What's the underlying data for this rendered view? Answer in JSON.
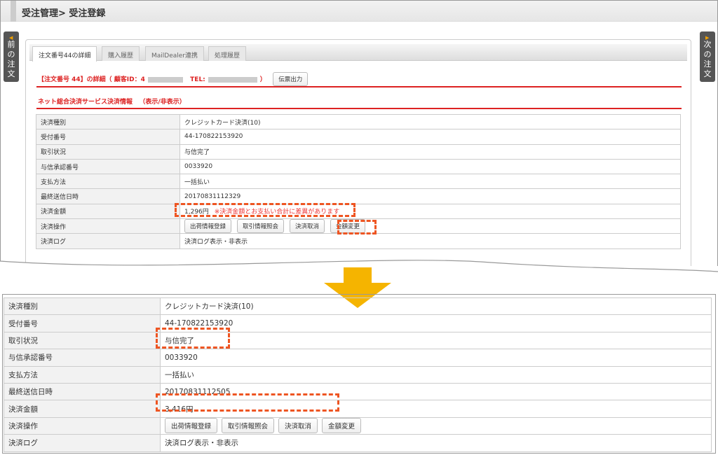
{
  "header": {
    "breadcrumb": "受注管理> 受注登録"
  },
  "side": {
    "prev": [
      "前",
      "の",
      "注",
      "文"
    ],
    "next": [
      "次",
      "の",
      "注",
      "文"
    ]
  },
  "tabs": [
    "注文番号44の詳細",
    "購入履歴",
    "MailDealer連携",
    "処理履歴"
  ],
  "order": {
    "title": "【注文番号 44】の詳細（ 顧客ID：4",
    "tel": "TEL:",
    "close": "）",
    "slip_button": "伝票出力"
  },
  "section": {
    "title": "ネット総合決済サービス決済情報",
    "toggle": "（表示/非表示）"
  },
  "before": {
    "rows": [
      {
        "label": "決済種別",
        "value": "クレジットカード決済(10)"
      },
      {
        "label": "受付番号",
        "value": "44-170822153920"
      },
      {
        "label": "取引状況",
        "value": "与信完了"
      },
      {
        "label": "与信承認番号",
        "value": "0033920"
      },
      {
        "label": "支払方法",
        "value": "一括払い"
      },
      {
        "label": "最終送信日時",
        "value": "20170831112329"
      },
      {
        "label": "決済金額",
        "value": "1,296円",
        "warning": "※決済金額とお支払い合計に差異があります"
      },
      {
        "label": "決済操作"
      },
      {
        "label": "決済ログ",
        "value": "決済ログ表示・非表示"
      }
    ]
  },
  "after": {
    "rows": [
      {
        "label": "決済種別",
        "value": "クレジットカード決済(10)"
      },
      {
        "label": "受付番号",
        "value": "44-170822153920"
      },
      {
        "label": "取引状況",
        "value": "与信完了"
      },
      {
        "label": "与信承認番号",
        "value": "0033920"
      },
      {
        "label": "支払方法",
        "value": "一括払い"
      },
      {
        "label": "最終送信日時",
        "value": "20170831112505"
      },
      {
        "label": "決済金額",
        "value": "3,416円"
      },
      {
        "label": "決済操作"
      },
      {
        "label": "決済ログ",
        "value": "決済ログ表示・非表示"
      }
    ]
  },
  "ops": [
    "出荷情報登録",
    "取引情報照会",
    "決済取消",
    "金額変更"
  ],
  "colors": {
    "highlight": "#e52",
    "arrow": "#f5b400",
    "heading": "#d22"
  }
}
